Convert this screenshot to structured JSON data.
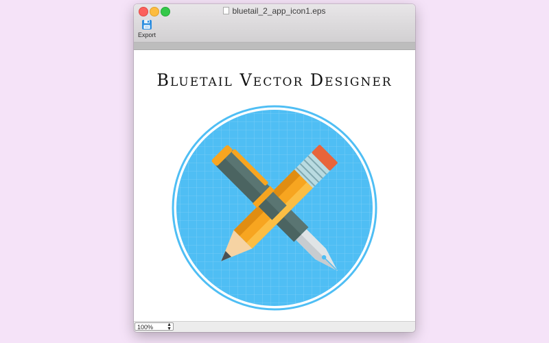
{
  "window": {
    "title": "bluetail_2_app_icon1.eps"
  },
  "toolbar": {
    "export_label": "Export"
  },
  "document": {
    "heading": "Bluetail Vector Designer"
  },
  "statusbar": {
    "zoom": "100%"
  },
  "colors": {
    "desktop": "#f5e3f8",
    "logo_circle": "#4fbef4",
    "pencil_body": "#f7a520",
    "pen_body": "#5a7572"
  }
}
